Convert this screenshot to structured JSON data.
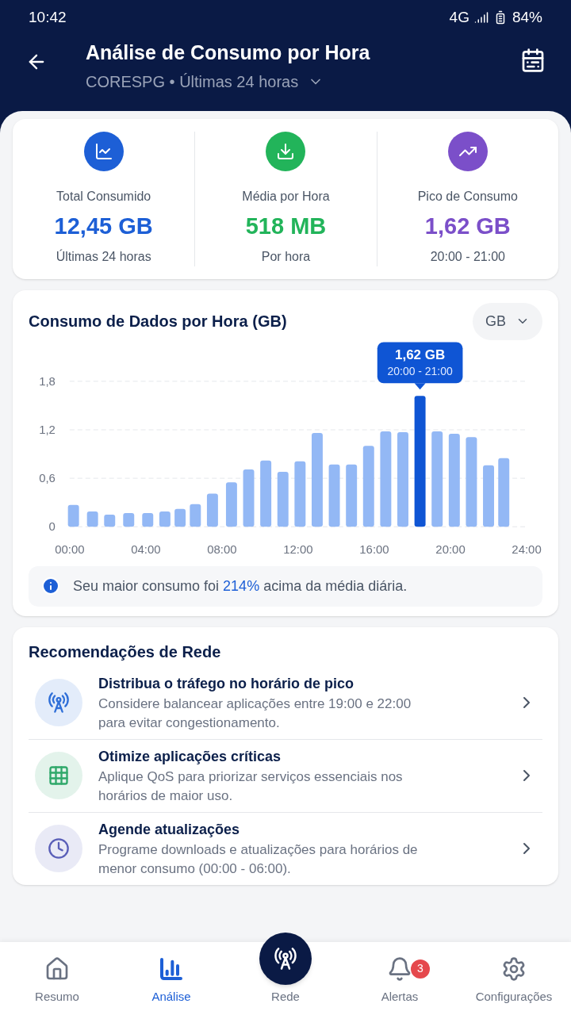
{
  "status_bar": {
    "time": "10:42",
    "network": "4G",
    "battery": "84%"
  },
  "header": {
    "title": "Análise de Consumo por Hora",
    "subtitle": "CORESPG • Últimas 24 horas"
  },
  "stats": [
    {
      "kind": "total",
      "label": "Total Consumido",
      "value": "12,45 GB",
      "note": "Últimas 24 horas",
      "color": "#1d5fd6"
    },
    {
      "kind": "average",
      "label": "Média por Hora",
      "value": "518 MB",
      "note": "Por hora",
      "color": "#22b45a"
    },
    {
      "kind": "peak",
      "label": "Pico de Consumo",
      "value": "1,62 GB",
      "note": "20:00 - 21:00",
      "color": "#7b4fc9"
    }
  ],
  "chart_card": {
    "title": "Consumo de Dados por Hora (GB)",
    "unit_select": "GB",
    "chart_data": {
      "type": "bar",
      "x": [
        0.2,
        1.2,
        2.1,
        3.1,
        4.1,
        5.0,
        5.8,
        6.6,
        7.5,
        8.5,
        9.4,
        10.3,
        11.2,
        12.1,
        13.0,
        13.9,
        14.8,
        15.7,
        16.6,
        17.5,
        18.4,
        19.3,
        20.2,
        21.1,
        22.0,
        22.8
      ],
      "series": [
        {
          "color": "#93b8f5",
          "values": [
            0.27,
            0.19,
            0.15,
            0.17,
            0.17,
            0.19,
            0.22,
            0.28,
            0.41,
            0.55,
            0.71,
            0.82,
            0.68,
            0.81,
            1.16,
            0.77,
            0.77,
            1.0,
            1.18,
            1.17,
            null,
            1.18,
            1.15,
            1.11,
            0.76,
            0.85
          ]
        },
        {
          "color": "#0f55d4",
          "values": [
            null,
            null,
            null,
            null,
            null,
            null,
            null,
            null,
            null,
            null,
            null,
            null,
            null,
            null,
            null,
            null,
            null,
            null,
            null,
            null,
            1.62,
            null,
            null,
            null,
            null,
            null
          ]
        }
      ],
      "xlim": [
        0,
        24
      ],
      "ylim": [
        0,
        1.8
      ],
      "xticks": [
        {
          "value": 0,
          "label": "00:00"
        },
        {
          "value": 4,
          "label": "04:00"
        },
        {
          "value": 8,
          "label": "08:00"
        },
        {
          "value": 12,
          "label": "12:00"
        },
        {
          "value": 16,
          "label": "16:00"
        },
        {
          "value": 20,
          "label": "20:00"
        },
        {
          "value": 24,
          "label": "24:00"
        }
      ],
      "yticks": [
        {
          "value": 0,
          "label": "0"
        },
        {
          "value": 0.6,
          "label": "0,6"
        },
        {
          "value": 1.2,
          "label": "1,2"
        },
        {
          "value": 1.8,
          "label": "1,8"
        }
      ]
    },
    "tooltip": {
      "value": "1,62 GB",
      "period": "20:00 - 21:00"
    },
    "insight": {
      "before": "Seu maior consumo foi ",
      "highlight": "214%",
      "after": " acima da média diária."
    }
  },
  "recommendations": {
    "title": "Recomendações de Rede",
    "items": [
      {
        "kind": "tower",
        "title": "Distribua o tráfego no horário de pico",
        "description": "Considere balancear aplicações entre 19:00 e 22:00 para evitar congestionamento.",
        "color": "#2f6fd8"
      },
      {
        "kind": "grid",
        "title": "Otimize aplicações críticas",
        "description": "Aplique QoS para priorizar serviços essenciais nos horários de maior uso.",
        "color": "#2fa86a"
      },
      {
        "kind": "clock",
        "title": "Agende atualizações",
        "description": "Programe downloads e atualizações para horários de menor consumo (00:00 - 06:00).",
        "color": "#5a5fb8"
      }
    ]
  },
  "nav": [
    {
      "kind": "home",
      "label": "Resumo",
      "selected": false
    },
    {
      "kind": "chart",
      "label": "Análise",
      "selected": true
    },
    {
      "kind": "tower",
      "label": "Rede",
      "selected": false
    },
    {
      "kind": "bell",
      "label": "Alertas",
      "selected": false,
      "badge": "3"
    },
    {
      "kind": "gear",
      "label": "Configurações",
      "selected": false
    }
  ]
}
